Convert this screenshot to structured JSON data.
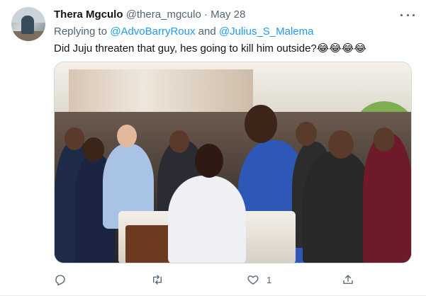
{
  "tweet": {
    "name": "Thera Mgculo",
    "handle": "@thera_mgculo",
    "separator": "·",
    "date": "May 28",
    "replying_prefix": "Replying to",
    "reply_user_1": "@AdvoBarryRoux",
    "reply_and": "and",
    "reply_user_2": "@Julius_S_Malema",
    "text": "Did Juju threaten that guy, hes going to kill him outside?😂😂😂😂"
  },
  "actions": {
    "reply_icon": "reply-icon",
    "retweet_icon": "retweet-icon",
    "like_icon": "heart-icon",
    "like_count": "1",
    "share_icon": "share-icon"
  },
  "colors": {
    "link": "#1d9bf0",
    "secondary_text": "#536471",
    "primary_text": "#0f1419"
  }
}
